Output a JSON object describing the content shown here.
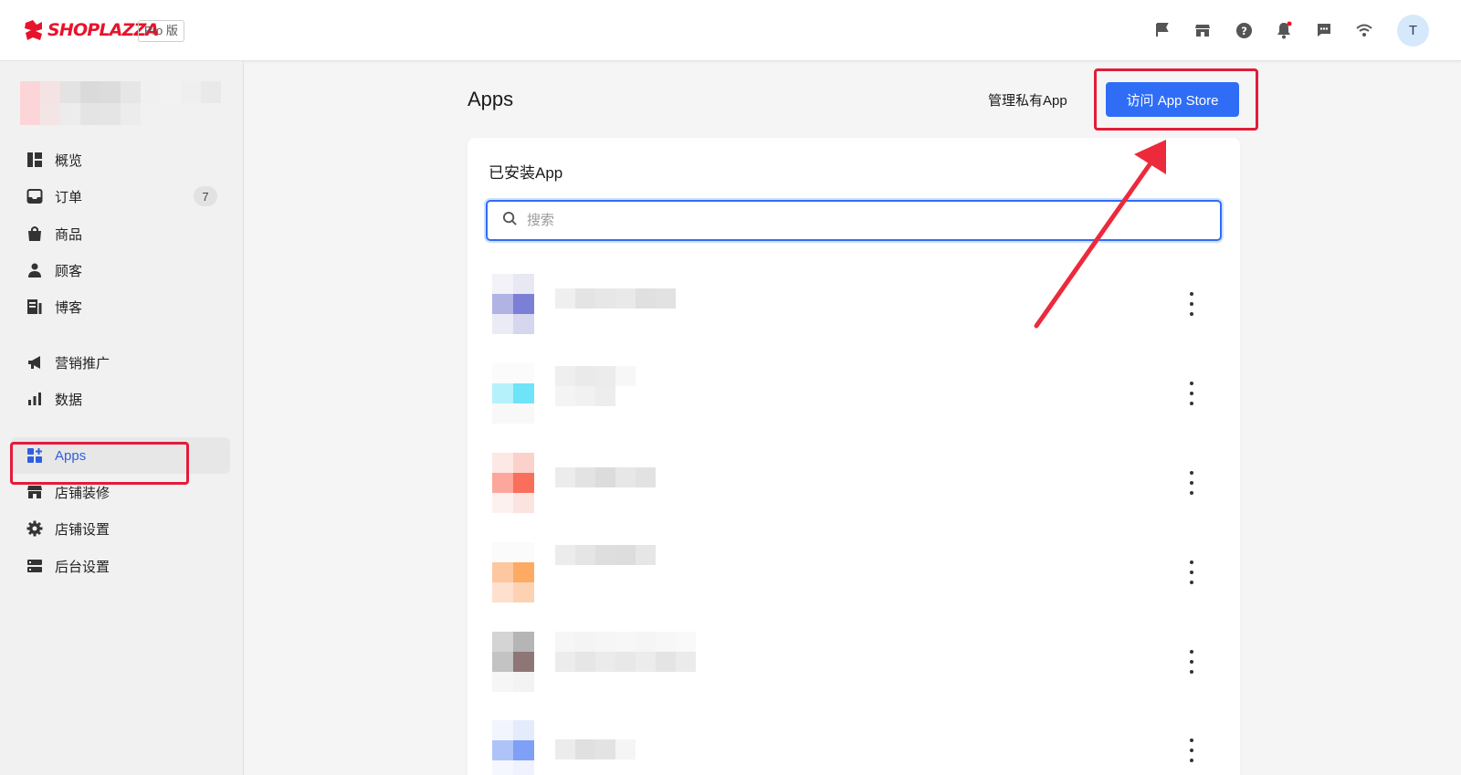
{
  "topbar": {
    "brand": "SHOPLAZZA",
    "plan_badge": "Pro 版",
    "icons": [
      "flag-icon",
      "storefront-icon",
      "help-icon",
      "notification-bell-icon",
      "chat-icon",
      "wifi-icon"
    ],
    "avatar_letter": "T"
  },
  "sidebar": {
    "items": [
      {
        "label": "概览",
        "icon": "dashboard-icon"
      },
      {
        "label": "订单",
        "icon": "inbox-icon",
        "badge": "7"
      },
      {
        "label": "商品",
        "icon": "shopping-bag-icon"
      },
      {
        "label": "顾客",
        "icon": "person-icon"
      },
      {
        "label": "博客",
        "icon": "blog-icon"
      },
      {
        "label": "营销推广",
        "icon": "megaphone-icon"
      },
      {
        "label": "数据",
        "icon": "bar-chart-icon"
      },
      {
        "label": "Apps",
        "icon": "apps-grid-icon",
        "active": true
      },
      {
        "label": "店铺装修",
        "icon": "storefront-icon"
      },
      {
        "label": "店铺设置",
        "icon": "gear-icon"
      },
      {
        "label": "后台设置",
        "icon": "server-icon"
      }
    ]
  },
  "main": {
    "title": "Apps",
    "manage_private_apps": "管理私有App",
    "visit_store_button": "访问 App Store",
    "installed_title": "已安装App",
    "search_placeholder": "搜索",
    "apps": [
      {
        "icon_color": "#7b7fd6"
      },
      {
        "icon_color": "#6fe3f7"
      },
      {
        "icon_color": "#fa6f5c"
      },
      {
        "icon_color": "#fdab63"
      },
      {
        "icon_color": "#8e7677"
      },
      {
        "icon_color": "#7ea1f6"
      }
    ]
  },
  "colors": {
    "primary": "#2f6df6",
    "brand": "#e8132b",
    "annotation": "#e21c3a"
  }
}
